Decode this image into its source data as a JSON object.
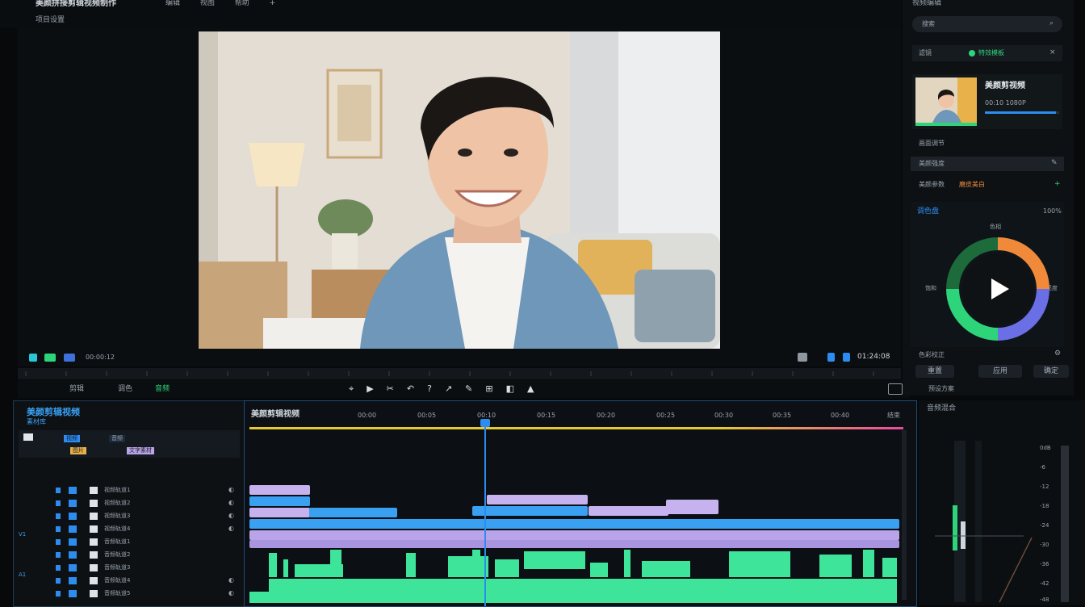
{
  "app": {
    "title": "美颜拼接剪辑视频制作",
    "menu": [
      "编辑",
      "视图",
      "帮助"
    ],
    "subtitle": "项目设置"
  },
  "preview": {
    "timecode_left": "00:00:12",
    "timecode_right": "01:24:08"
  },
  "transport": {
    "tabs": [
      "剪辑",
      "调色",
      "音频"
    ],
    "tools": [
      "⌖",
      "▶",
      "✂",
      "↶",
      "?",
      "↗",
      "✎",
      "⊞",
      "◧",
      "▲"
    ]
  },
  "right_panel": {
    "header": "视频编辑",
    "search_placeholder": "搜索",
    "tab_active": "特效模板",
    "tab_left": "滤镜",
    "thumb_title": "美颜剪视频",
    "thumb_meta": "00:10  1080P",
    "section_label": "画面调节",
    "field_value": "美颜强度",
    "field_row": "美颜参数",
    "field_accent": "磨皮美白",
    "color_header": "调色盘",
    "color_percent": "100%",
    "wheel_top": "色相",
    "wheel_left": "饱和",
    "wheel_right": "亮度",
    "bottom_row_label": "色彩校正",
    "bottom_btns": [
      "重置",
      "应用",
      "确定"
    ],
    "bottom_caption": "预设方案"
  },
  "bin": {
    "title": "美颜剪辑视频",
    "subtitle": "素材库",
    "chips": [
      "视频",
      "音频"
    ],
    "chips2": [
      "图片",
      "文字素材"
    ],
    "rows": [
      "视频轨道1",
      "视频轨道2",
      "视频轨道3",
      "视频轨道4",
      "音频轨道1",
      "音频轨道2",
      "音频轨道3",
      "音频轨道4",
      "音频轨道5"
    ],
    "side_labels": [
      "V1",
      "A1"
    ]
  },
  "timeline": {
    "title": "美颜剪辑视频",
    "ruler": [
      "00:00",
      "00:05",
      "00:10",
      "00:15",
      "00:20",
      "00:25",
      "00:30",
      "00:35",
      "00:40",
      "结束"
    ]
  },
  "mixer": {
    "title": "音频混合",
    "labels": [
      "0dB",
      "-6",
      "-12",
      "-18",
      "-24",
      "-30",
      "-36",
      "-42",
      "-48"
    ]
  },
  "colors": {
    "accent_blue": "#2d8cf0",
    "accent_green": "#2ed47a",
    "clip_purple": "#b9a4ea",
    "clip_blue": "#3aa0f2",
    "clip_green": "#3ee49a"
  }
}
